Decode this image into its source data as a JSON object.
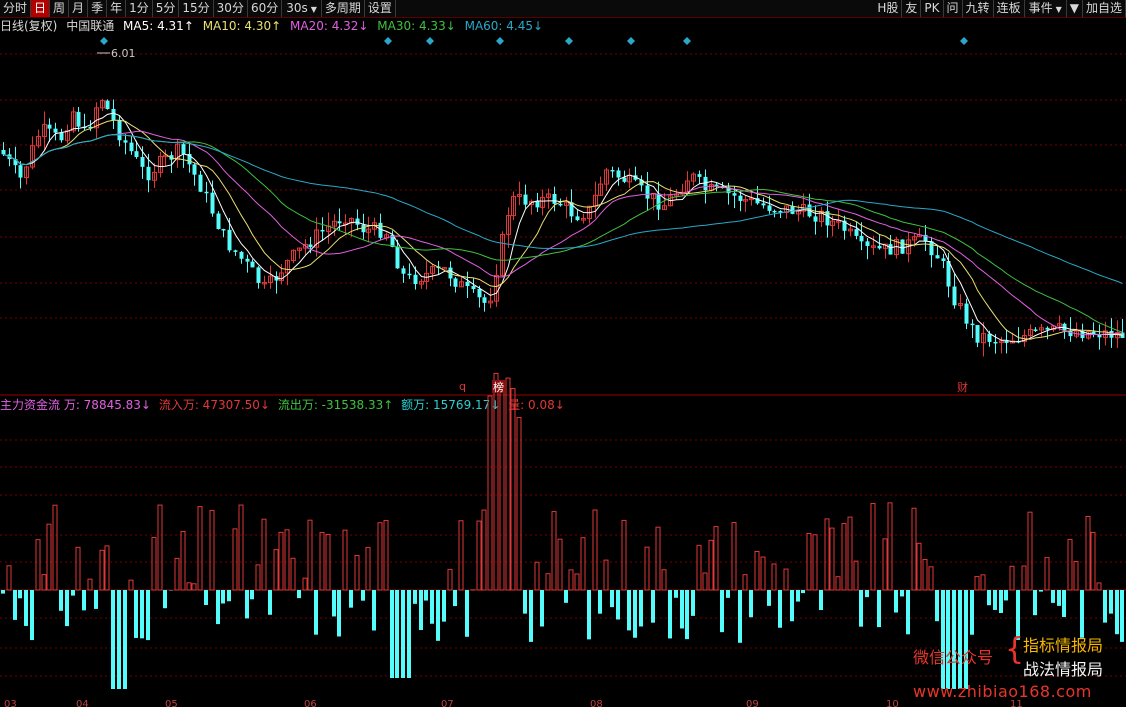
{
  "toolbar": {
    "left": [
      {
        "id": "fenshi",
        "label": "分时",
        "active": false
      },
      {
        "id": "day",
        "label": "日",
        "active": true
      },
      {
        "id": "week",
        "label": "周",
        "active": false
      },
      {
        "id": "month",
        "label": "月",
        "active": false
      },
      {
        "id": "season",
        "label": "季",
        "active": false
      },
      {
        "id": "year",
        "label": "年",
        "active": false
      },
      {
        "id": "m1",
        "label": "1分",
        "active": false
      },
      {
        "id": "m5",
        "label": "5分",
        "active": false
      },
      {
        "id": "m15",
        "label": "15分",
        "active": false
      },
      {
        "id": "m30",
        "label": "30分",
        "active": false
      },
      {
        "id": "m60",
        "label": "60分",
        "active": false
      },
      {
        "id": "s30",
        "label": "30s",
        "active": false,
        "dropdown": true
      },
      {
        "id": "multi",
        "label": "多周期",
        "active": false
      },
      {
        "id": "settings",
        "label": "设置",
        "active": false
      }
    ],
    "right": [
      {
        "id": "h",
        "label": "H股"
      },
      {
        "id": "you",
        "label": "友"
      },
      {
        "id": "pk",
        "label": "PK"
      },
      {
        "id": "wen",
        "label": "问"
      },
      {
        "id": "jiuzhuan",
        "label": "九转"
      },
      {
        "id": "lianban",
        "label": "连板"
      },
      {
        "id": "event",
        "label": "事件",
        "dropdown": true
      },
      {
        "id": "more",
        "label": "▼"
      },
      {
        "id": "addsel",
        "label": "加自选"
      }
    ]
  },
  "info": {
    "period": "日线(复权)",
    "stock": "中国联通",
    "ma5": "MA5: 4.31↑",
    "ma10": "MA10: 4.30↑",
    "ma20": "MA20: 4.32↓",
    "ma30": "MA30: 4.33↓",
    "ma60": "MA60: 4.45↓"
  },
  "fund": {
    "title": "主力资金流 万: 78845.83↓",
    "inflow": "流入万: 47307.50↓",
    "outflow": "流出万: -31538.33↑",
    "amount": "额万: 15769.17↓",
    "volume": "量: 0.08↓"
  },
  "markers": {
    "high_label": "6.01",
    "q": "q",
    "bang": "榜",
    "cai": "财"
  },
  "xaxis": [
    "03",
    "04",
    "05",
    "06",
    "07",
    "08",
    "09",
    "10",
    "11"
  ],
  "colors": {
    "up": "#e03838",
    "down": "#54fcfc",
    "ma5": "#ffffff",
    "ma10": "#e8e070",
    "ma20": "#e060e0",
    "ma30": "#40c040",
    "ma60": "#2aa8c8",
    "grid": "#7a0000"
  },
  "watermark": {
    "left": "微信公众号",
    "brace": "{",
    "right1": "指标情报局",
    "right2": "战法情报局",
    "url": "www.zhibiao168.com"
  }
}
